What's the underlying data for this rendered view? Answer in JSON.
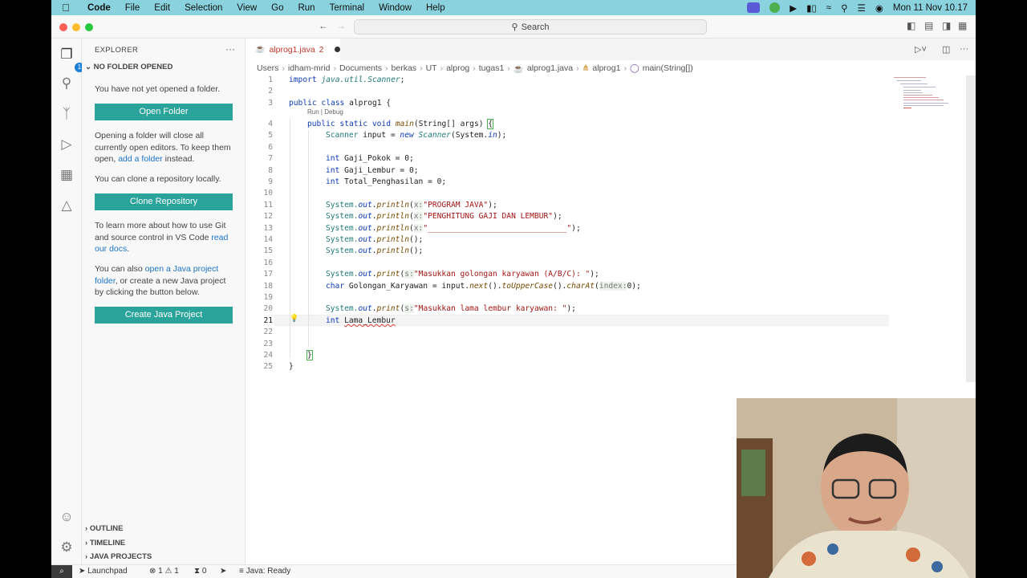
{
  "menubar": {
    "app": "Code",
    "items": [
      "File",
      "Edit",
      "Selection",
      "View",
      "Go",
      "Run",
      "Terminal",
      "Window",
      "Help"
    ],
    "clock": "Mon 11 Nov  10.17"
  },
  "titlebar": {
    "search_label": "Search"
  },
  "sidebar": {
    "title": "EXPLORER",
    "section": "NO FOLDER OPENED",
    "msg_not_opened": "You have not yet opened a folder.",
    "btn_open_folder": "Open Folder",
    "msg_close_pre": "Opening a folder will close all currently open editors. To keep them open, ",
    "msg_close_link": "add a folder",
    "msg_close_post": " instead.",
    "msg_clone": "You can clone a repository locally.",
    "btn_clone": "Clone Repository",
    "msg_git_pre": "To learn more about how to use Git and source control in VS Code ",
    "msg_git_link": "read our docs",
    "msg_git_post": ".",
    "msg_java_pre": "You can also ",
    "msg_java_link": "open a Java project folder",
    "msg_java_post": ", or create a new Java project by clicking the button below.",
    "btn_create_java": "Create Java Project",
    "outline": "OUTLINE",
    "timeline": "TIMELINE",
    "java_projects": "JAVA PROJECTS",
    "activity_badge": "1"
  },
  "editor": {
    "tab_label": "alprog1.java",
    "tab_problems": "2",
    "breadcrumb": [
      "Users",
      "idham-mrid",
      "Documents",
      "berkas",
      "UT",
      "alprog",
      "tugas1",
      "alprog1.java",
      "alprog1",
      "main(String[])"
    ],
    "codelens": "Run | Debug",
    "line_numbers": [
      "1",
      "2",
      "3",
      "4",
      "5",
      "6",
      "7",
      "8",
      "9",
      "10",
      "11",
      "12",
      "13",
      "14",
      "15",
      "16",
      "17",
      "18",
      "19",
      "20",
      "21",
      "22",
      "23",
      "24",
      "25"
    ],
    "code": {
      "l1_kw": "import ",
      "l1_pkg": "java.util.Scanner",
      "l1_end": ";",
      "l3_kw": "public class ",
      "l3_name": "alprog1 {",
      "l4_kw": "public static void ",
      "l4_fn": "main",
      "l4_rest": "(String[] args) ",
      "l4_brace": "{",
      "l5_cls": "Scanner",
      "l5_a": " input = ",
      "l5_new": "new ",
      "l5_ctor": "Scanner",
      "l5_b": "(System.",
      "l5_in": "in",
      "l5_c": ");",
      "l7_kw": "int ",
      "l7_rest": "Gaji_Pokok = 0;",
      "l8_kw": "int ",
      "l8_rest": "Gaji_Lembur = 0;",
      "l9_kw": "int ",
      "l9_rest": "Total_Penghasilan = 0;",
      "sys": "System.",
      "out": "out",
      "dot": ".",
      "println": "println",
      "print": "print",
      "hint_x": "x:",
      "hint_s": "s:",
      "l11_str": "\"PROGRAM JAVA\"",
      "l11_end": ");",
      "l12_str": "\"PENGHITUNG GAJI DAN LEMBUR\"",
      "l12_end": ");",
      "l13_str": "\"______________________________\"",
      "l13_end": ");",
      "empty_call": "();",
      "l17_str": "\"Masukkan golongan karyawan (A/B/C): \"",
      "l17_end": ");",
      "l18_kw": "char ",
      "l18_a": "Golongan_Karyawan = input.",
      "l18_next": "next",
      "l18_b": "().",
      "l18_upper": "toUpperCase",
      "l18_c": "().",
      "l18_charat": "charAt",
      "l18_d": "(",
      "l18_hint": "index:",
      "l18_e": "0);",
      "l20_str": "\"Masukkan lama lembur karyawan: \"",
      "l20_end": ");",
      "l21_kw": "int ",
      "l21_rest": "Lama_Lembur",
      "l24": "}",
      "l25": "}"
    }
  },
  "status": {
    "launchpad": "Launchpad",
    "errors": "1",
    "warnings": "1",
    "ports": "0",
    "java": "Java: Ready"
  },
  "colors": {
    "menubar_bg": "#8ad3de",
    "button_teal": "#2aa39a",
    "link_blue": "#1a73c8",
    "tab_modified_red": "#c0392b"
  }
}
